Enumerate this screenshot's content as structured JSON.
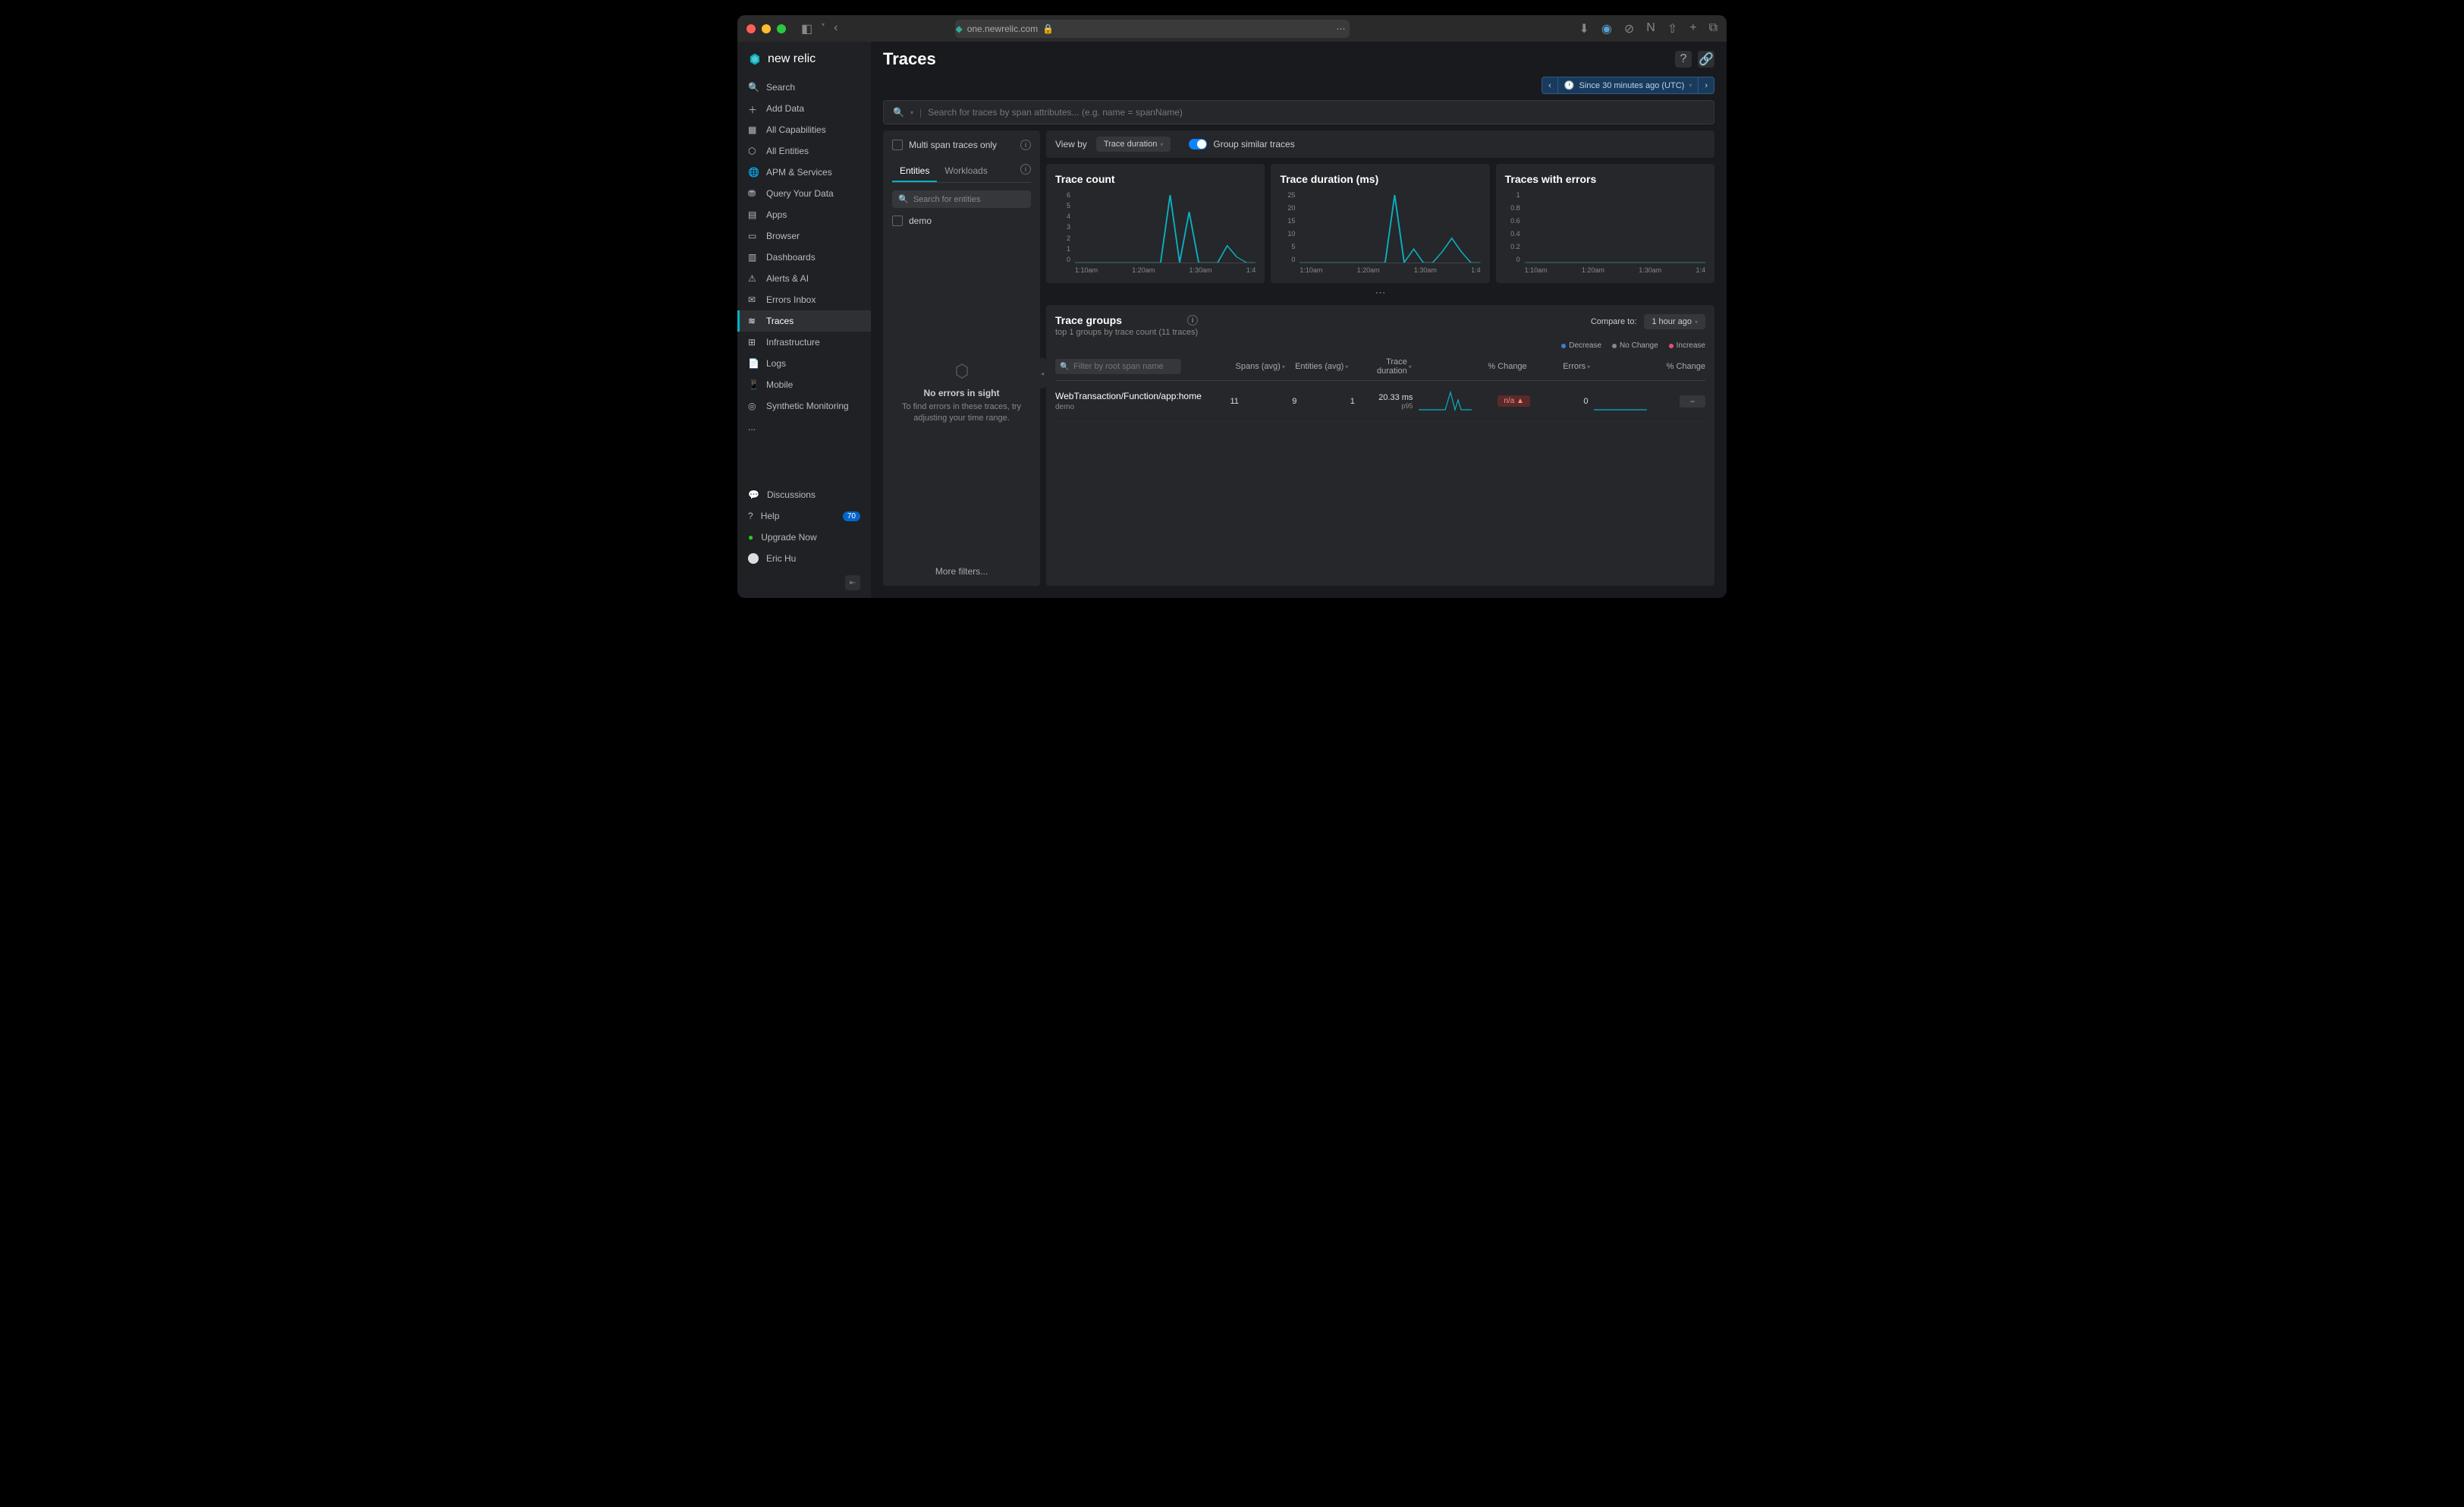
{
  "browser": {
    "url": "one.newrelic.com"
  },
  "brand": "new relic",
  "sidebar": {
    "items": [
      {
        "label": "Search",
        "icon": "search"
      },
      {
        "label": "Add Data",
        "icon": "plus"
      },
      {
        "label": "All Capabilities",
        "icon": "grid"
      },
      {
        "label": "All Entities",
        "icon": "hex"
      },
      {
        "label": "APM & Services",
        "icon": "globe"
      },
      {
        "label": "Query Your Data",
        "icon": "db"
      },
      {
        "label": "Apps",
        "icon": "apps"
      },
      {
        "label": "Browser",
        "icon": "browser"
      },
      {
        "label": "Dashboards",
        "icon": "dash"
      },
      {
        "label": "Alerts & AI",
        "icon": "alert"
      },
      {
        "label": "Errors Inbox",
        "icon": "inbox"
      },
      {
        "label": "Traces",
        "icon": "traces",
        "active": true
      },
      {
        "label": "Infrastructure",
        "icon": "infra"
      },
      {
        "label": "Logs",
        "icon": "logs"
      },
      {
        "label": "Mobile",
        "icon": "mobile"
      },
      {
        "label": "Synthetic Monitoring",
        "icon": "synth"
      }
    ],
    "more": "...",
    "bottom": [
      {
        "label": "Discussions",
        "icon": "chat"
      },
      {
        "label": "Help",
        "icon": "help",
        "badge": "70"
      },
      {
        "label": "Upgrade Now",
        "icon": "upgrade"
      },
      {
        "label": "Eric Hu",
        "icon": "avatar"
      }
    ]
  },
  "page": {
    "title": "Traces",
    "timerange": "Since 30 minutes ago (UTC)",
    "search_placeholder": "Search for traces by span attributes... (e.g. name = spanName)"
  },
  "filter_panel": {
    "multi_span_label": "Multi span traces only",
    "tabs": {
      "entities": "Entities",
      "workloads": "Workloads"
    },
    "entity_search_placeholder": "Search for entities",
    "entity_items": [
      "demo"
    ],
    "empty_title": "No errors in sight",
    "empty_body": "To find errors in these traces, try adjusting your time range.",
    "more_filters": "More filters..."
  },
  "toolbar": {
    "view_by": "View by",
    "view_by_value": "Trace duration",
    "group_similar": "Group similar traces"
  },
  "chart_data": [
    {
      "type": "line",
      "title": "Trace count",
      "y_ticks": [
        "6",
        "5",
        "4",
        "3",
        "2",
        "1",
        "0"
      ],
      "x_ticks": [
        "1:10am",
        "1:20am",
        "1:30am",
        "1:4"
      ],
      "x": [
        0,
        1,
        2,
        3,
        4,
        5,
        6,
        7,
        8,
        9,
        10,
        11,
        12,
        13,
        14,
        15,
        16,
        17,
        18,
        19
      ],
      "values": [
        0,
        0,
        0,
        0,
        0,
        0,
        0,
        0,
        0,
        0,
        6,
        0,
        4.5,
        0,
        0,
        0,
        1.5,
        0.5,
        0,
        0
      ],
      "ylim": [
        0,
        6
      ]
    },
    {
      "type": "line",
      "title": "Trace duration (ms)",
      "y_ticks": [
        "25",
        "20",
        "15",
        "10",
        "5",
        "0"
      ],
      "x_ticks": [
        "1:10am",
        "1:20am",
        "1:30am",
        "1:4"
      ],
      "x": [
        0,
        1,
        2,
        3,
        4,
        5,
        6,
        7,
        8,
        9,
        10,
        11,
        12,
        13,
        14,
        15,
        16,
        17,
        18,
        19
      ],
      "values": [
        0,
        0,
        0,
        0,
        0,
        0,
        0,
        0,
        0,
        0,
        25,
        0,
        5,
        0,
        0,
        4,
        9,
        4,
        0,
        0
      ],
      "ylim": [
        0,
        25
      ]
    },
    {
      "type": "line",
      "title": "Traces with errors",
      "y_ticks": [
        "1",
        "0.8",
        "0.6",
        "0.4",
        "0.2",
        "0"
      ],
      "x_ticks": [
        "1:10am",
        "1:20am",
        "1:30am",
        "1:4"
      ],
      "x": [
        0,
        1,
        2,
        3,
        4,
        5,
        6,
        7,
        8,
        9,
        10,
        11,
        12,
        13,
        14,
        15,
        16,
        17,
        18,
        19
      ],
      "values": [
        0,
        0,
        0,
        0,
        0,
        0,
        0,
        0,
        0,
        0,
        0,
        0,
        0,
        0,
        0,
        0,
        0,
        0,
        0,
        0
      ],
      "ylim": [
        0,
        1
      ]
    }
  ],
  "groups": {
    "title": "Trace groups",
    "subtitle": "top 1 groups by trace count (11 traces)",
    "compare_label": "Compare to:",
    "compare_value": "1 hour ago",
    "legend": {
      "decrease": "Decrease",
      "nochange": "No Change",
      "increase": "Increase"
    },
    "filter_placeholder": "Filter by root span name",
    "columns": [
      "Spans (avg)",
      "Entities (avg)",
      "Trace duration",
      "% Change",
      "Errors",
      "% Change"
    ],
    "rows": [
      {
        "name": "WebTransaction/Function/app:home",
        "entity": "demo",
        "spans": "11",
        "entities": "9",
        "count": "1",
        "duration": "20.33 ms",
        "duration_sub": "p95",
        "change": "n/a ▲",
        "errors": "0",
        "err_change": "–"
      }
    ]
  },
  "colors": {
    "accent": "#0ab0bf",
    "decrease": "#3a7fd5",
    "nochange": "#888888",
    "increase": "#e84f7a"
  }
}
